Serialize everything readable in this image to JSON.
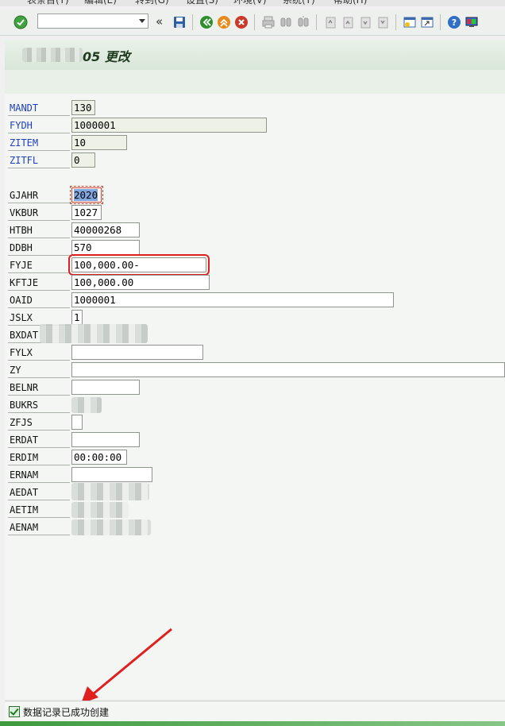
{
  "menu": {
    "items": [
      "表条目(T)",
      "编辑(E)",
      "转到(G)",
      "设置(S)",
      "环境(V)",
      "系统(Y)",
      "帮助(H)"
    ]
  },
  "toolbar": {
    "command_field_value": "",
    "icons": [
      "check-icon",
      "collapse-icon",
      "save-icon",
      "back-icon",
      "exit-icon",
      "cancel-icon",
      "print-icon",
      "find-icon",
      "find-next-icon",
      "first-page-icon",
      "prev-page-icon",
      "next-page-icon",
      "last-page-icon",
      "create-session-icon",
      "shortcut-icon",
      "help-icon",
      "customize-icon"
    ]
  },
  "title": {
    "text": "05 更改"
  },
  "fields": [
    {
      "label": "MANDT",
      "value": "130",
      "key": true
    },
    {
      "label": "FYDH",
      "value": "1000001",
      "key": true
    },
    {
      "label": "ZITEM",
      "value": "10",
      "key": true
    },
    {
      "label": "ZITFL",
      "value": "0",
      "key": true
    },
    {
      "label": "GJAHR",
      "value": "2020"
    },
    {
      "label": "VKBUR",
      "value": "1027"
    },
    {
      "label": "HTBH",
      "value": "40000268"
    },
    {
      "label": "DDBH",
      "value": "570"
    },
    {
      "label": "FYJE",
      "value": "100,000.00-"
    },
    {
      "label": "KFTJE",
      "value": "100,000.00"
    },
    {
      "label": "OAID",
      "value": "1000001"
    },
    {
      "label": "JSLX",
      "value": "1"
    },
    {
      "label": "BXDAT",
      "value": ""
    },
    {
      "label": "FYLX",
      "value": ""
    },
    {
      "label": "ZY",
      "value": ""
    },
    {
      "label": "BELNR",
      "value": ""
    },
    {
      "label": "BUKRS",
      "value": ""
    },
    {
      "label": "ZFJS",
      "value": ""
    },
    {
      "label": "ERDAT",
      "value": ""
    },
    {
      "label": "ERDIM",
      "value": "00:00:00"
    },
    {
      "label": "ERNAM",
      "value": ""
    },
    {
      "label": "AEDAT",
      "value": ""
    },
    {
      "label": "AETIM",
      "value": ""
    },
    {
      "label": "AENAM",
      "value": ""
    }
  ],
  "status": {
    "message": "数据记录已成功创建"
  },
  "colors": {
    "key_label": "#1f3fbf",
    "highlight": "#e02020",
    "selection": "#7fa7e0"
  }
}
